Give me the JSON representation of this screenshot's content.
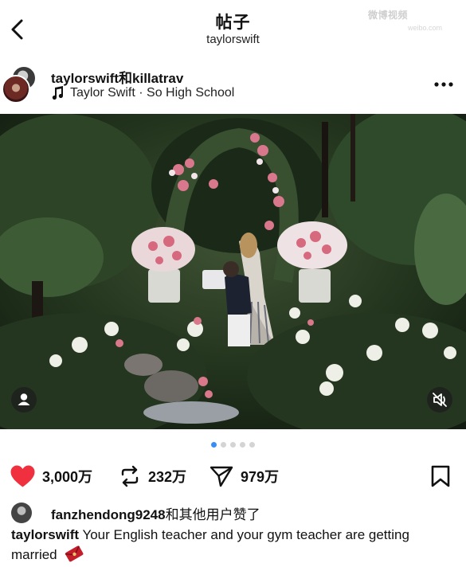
{
  "header": {
    "title": "帖子",
    "subtitle": "taylorswift",
    "watermark": "微博视频",
    "watermark_sub": "weibo.com"
  },
  "post": {
    "authors": "taylorswift和killatrav",
    "music": "Taylor Swift · So High School",
    "photo_alt": "Proposal in a garden with flowers",
    "carousel": {
      "total": 5,
      "current": 1
    }
  },
  "actions": {
    "likes": "3,000万",
    "reposts": "232万",
    "shares": "979万"
  },
  "liked_by": {
    "user": "fanzhendong9248",
    "suffix": "和其他用户赞了"
  },
  "caption": {
    "user": "taylorswift",
    "text": "Your English teacher and your gym teacher are getting married"
  },
  "icons": {
    "back": "chevron-left-icon",
    "more": "more-dots-icon",
    "music": "music-note-icon",
    "like": "heart-icon",
    "repost": "repost-icon",
    "share": "send-icon",
    "bookmark": "bookmark-icon",
    "user_tag": "user-icon",
    "mute": "muted-speaker-icon"
  },
  "colors": {
    "like": "#f0303f",
    "pager_active": "#3a8df2",
    "pager_inactive": "#d4d4d4"
  }
}
